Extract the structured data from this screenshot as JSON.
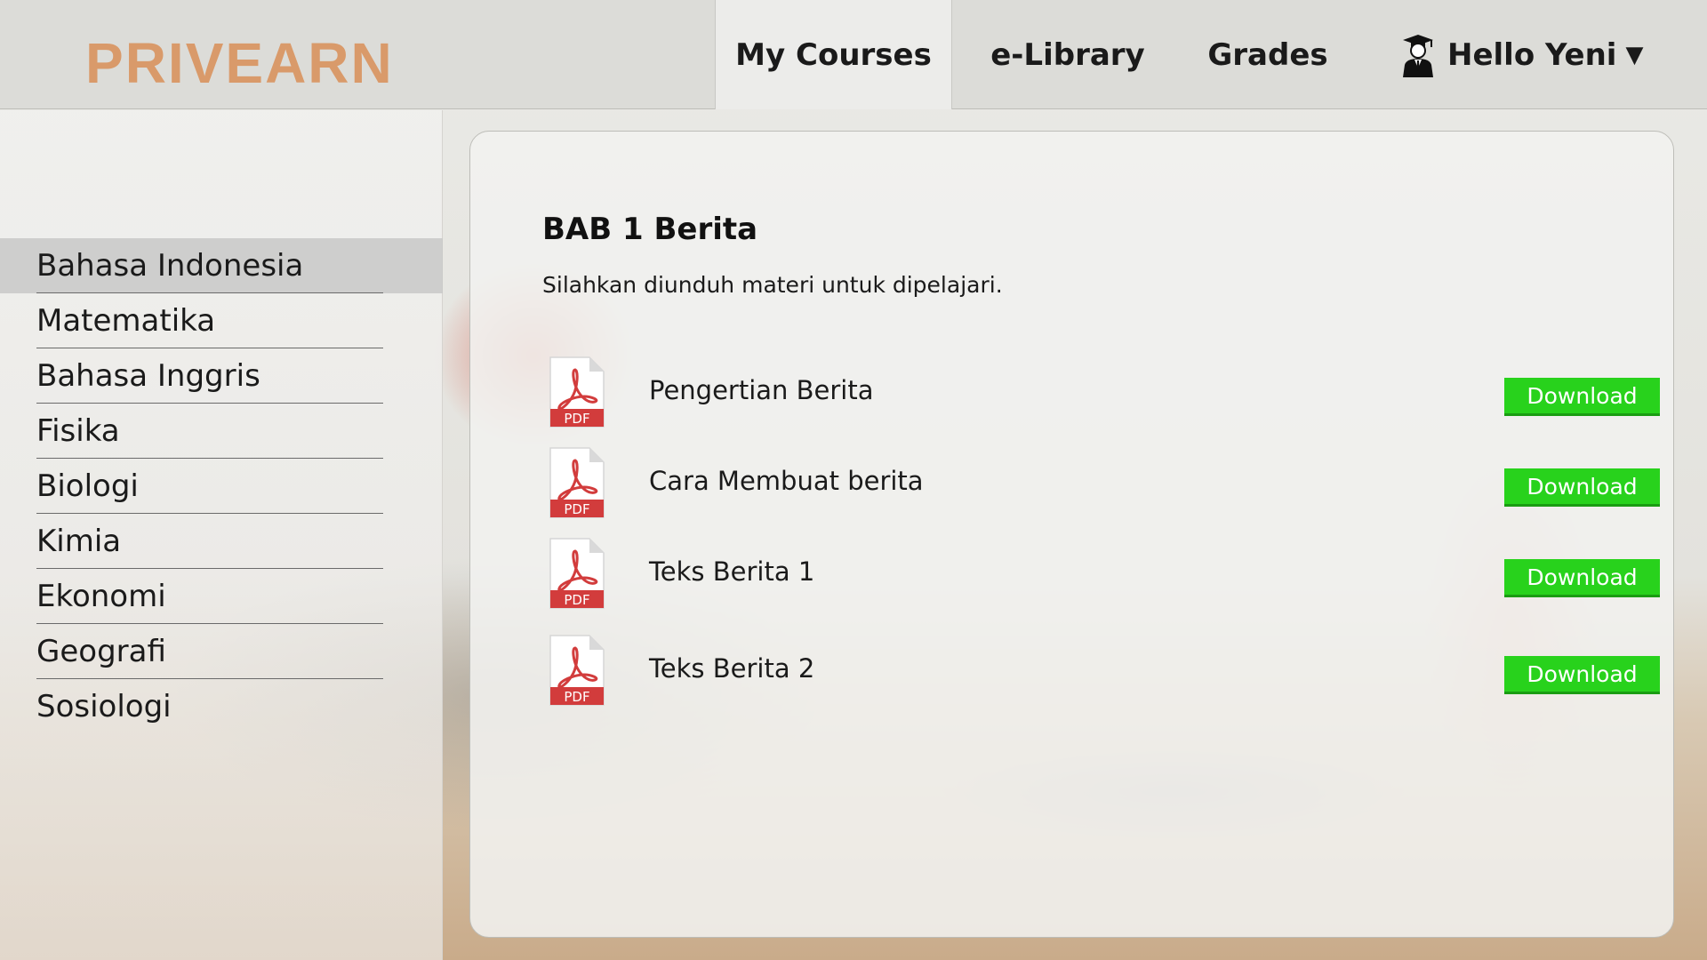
{
  "brand": {
    "name": "PRIVEARN",
    "color": "#d99a6a"
  },
  "nav": {
    "items": [
      {
        "label": "My Courses",
        "active": true
      },
      {
        "label": "e-Library",
        "active": false
      },
      {
        "label": "Grades",
        "active": false
      }
    ],
    "user": {
      "label": "Hello Yeni",
      "icon": "graduate-user-icon",
      "dropdown_icon": "caret-down-icon"
    }
  },
  "sidebar": {
    "items": [
      {
        "label": "Bahasa Indonesia",
        "active": true
      },
      {
        "label": "Matematika"
      },
      {
        "label": "Bahasa Inggris"
      },
      {
        "label": "Fisika"
      },
      {
        "label": "Biologi"
      },
      {
        "label": "Kimia"
      },
      {
        "label": "Ekonomi"
      },
      {
        "label": "Geografi"
      },
      {
        "label": "Sosiologi"
      }
    ]
  },
  "main": {
    "title": "BAB 1 Berita",
    "subtitle": "Silahkan diunduh materi untuk dipelajari.",
    "files": [
      {
        "name": "Pengertian Berita",
        "icon": "pdf-icon",
        "icon_text": "PDF",
        "button": "Download"
      },
      {
        "name": "Cara Membuat berita",
        "icon": "pdf-icon",
        "icon_text": "PDF",
        "button": "Download"
      },
      {
        "name": "Teks Berita 1",
        "icon": "pdf-icon",
        "icon_text": "PDF",
        "button": "Download"
      },
      {
        "name": "Teks Berita 2",
        "icon": "pdf-icon",
        "icon_text": "PDF",
        "button": "Download"
      }
    ]
  },
  "colors": {
    "download": "#28d21c",
    "pdf_red": "#d23c3c"
  }
}
